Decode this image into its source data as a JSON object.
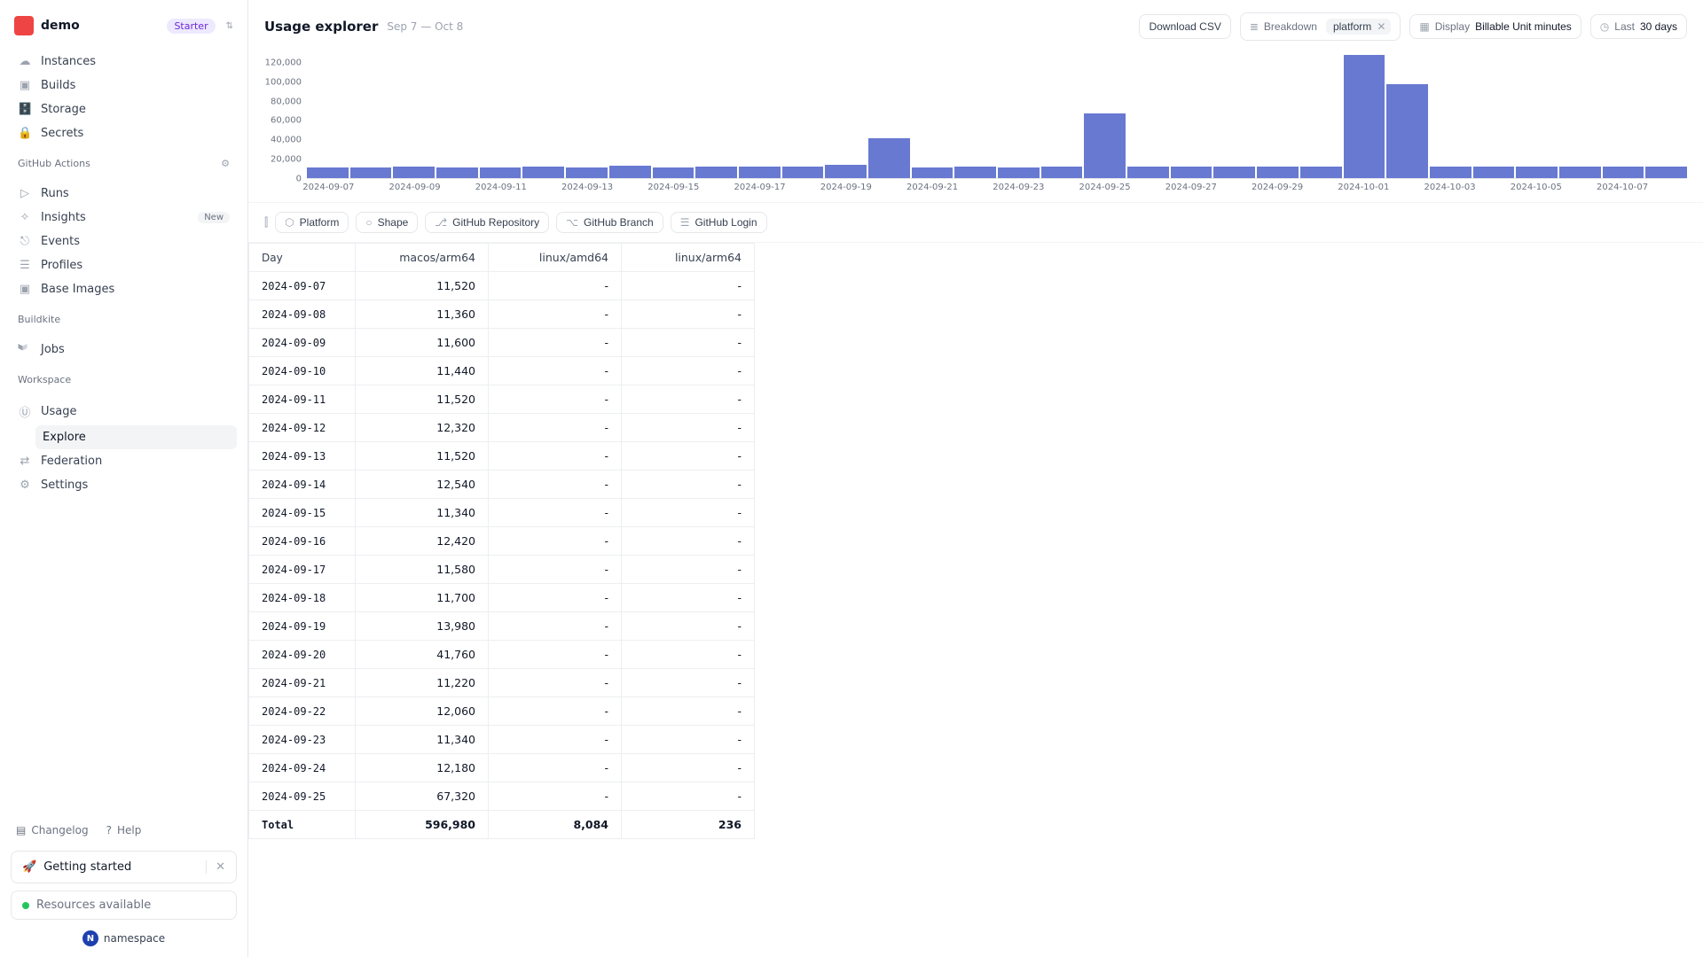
{
  "workspace": {
    "name": "demo",
    "badge": "Starter"
  },
  "sidebar": {
    "main": [
      {
        "icon": "☁",
        "label": "Instances"
      },
      {
        "icon": "▣",
        "label": "Builds"
      },
      {
        "icon": "🗄️",
        "label": "Storage"
      },
      {
        "icon": "🔒",
        "label": "Secrets"
      }
    ],
    "section_gh": "GitHub Actions",
    "gh": [
      {
        "icon": "▷",
        "label": "Runs"
      },
      {
        "icon": "✧",
        "label": "Insights",
        "pill": "New"
      },
      {
        "icon": "⎋",
        "label": "Events"
      },
      {
        "icon": "☰",
        "label": "Profiles"
      },
      {
        "icon": "▣",
        "label": "Base Images"
      }
    ],
    "section_bk": "Buildkite",
    "bk": [
      {
        "label": "Jobs"
      }
    ],
    "section_ws": "Workspace",
    "ws": [
      {
        "icon": "Ⓤ",
        "label": "Usage",
        "children": [
          {
            "label": "Explore",
            "active": true
          }
        ]
      },
      {
        "icon": "⇄",
        "label": "Federation"
      },
      {
        "icon": "⚙",
        "label": "Settings"
      }
    ],
    "footer": {
      "changelog": "Changelog",
      "help": "Help",
      "getting_started": "Getting started",
      "resources": "Resources available",
      "brand": "namespace"
    }
  },
  "header": {
    "title": "Usage explorer",
    "range": "Sep 7 — Oct 8",
    "download": "Download CSV",
    "breakdown_k": "Breakdown",
    "breakdown_chip": "platform",
    "display_k": "Display",
    "display_v": "Billable Unit minutes",
    "last_k": "Last",
    "last_v": "30 days"
  },
  "chart_data": {
    "type": "bar",
    "title": "",
    "xlabel": "",
    "ylabel": "",
    "ylim": [
      0,
      130000
    ],
    "yticks": [
      0,
      20000,
      40000,
      60000,
      80000,
      100000,
      120000
    ],
    "ytick_labels": [
      "0",
      "20,000",
      "40,000",
      "60,000",
      "80,000",
      "100,000",
      "120,000"
    ],
    "categories": [
      "2024-09-07",
      "2024-09-08",
      "2024-09-09",
      "2024-09-10",
      "2024-09-11",
      "2024-09-12",
      "2024-09-13",
      "2024-09-14",
      "2024-09-15",
      "2024-09-16",
      "2024-09-17",
      "2024-09-18",
      "2024-09-19",
      "2024-09-20",
      "2024-09-21",
      "2024-09-22",
      "2024-09-23",
      "2024-09-24",
      "2024-09-25",
      "2024-09-26",
      "2024-09-27",
      "2024-09-28",
      "2024-09-29",
      "2024-09-30",
      "2024-10-01",
      "2024-10-02",
      "2024-10-03",
      "2024-10-04",
      "2024-10-05",
      "2024-10-06",
      "2024-10-07",
      "2024-10-08"
    ],
    "xtick_every": 2,
    "values": [
      11520,
      11360,
      11600,
      11440,
      11520,
      12320,
      11520,
      12540,
      11340,
      12420,
      11580,
      11700,
      13980,
      41760,
      11220,
      12060,
      11340,
      12180,
      67320,
      12000,
      12000,
      12000,
      12000,
      12000,
      128000,
      98000,
      12000,
      12000,
      12000,
      12000,
      12000,
      12000
    ]
  },
  "filters": {
    "buttons": [
      {
        "icon": "⬡",
        "label": "Platform"
      },
      {
        "icon": "○",
        "label": "Shape"
      },
      {
        "icon": "⎇",
        "label": "GitHub Repository"
      },
      {
        "icon": "⌥",
        "label": "GitHub Branch"
      },
      {
        "icon": "☰",
        "label": "GitHub Login"
      }
    ]
  },
  "table": {
    "columns": [
      "Day",
      "macos/arm64",
      "linux/amd64",
      "linux/arm64"
    ],
    "rows": [
      {
        "day": "2024-09-07",
        "a": "11,520",
        "b": "-",
        "c": "-"
      },
      {
        "day": "2024-09-08",
        "a": "11,360",
        "b": "-",
        "c": "-"
      },
      {
        "day": "2024-09-09",
        "a": "11,600",
        "b": "-",
        "c": "-"
      },
      {
        "day": "2024-09-10",
        "a": "11,440",
        "b": "-",
        "c": "-"
      },
      {
        "day": "2024-09-11",
        "a": "11,520",
        "b": "-",
        "c": "-"
      },
      {
        "day": "2024-09-12",
        "a": "12,320",
        "b": "-",
        "c": "-"
      },
      {
        "day": "2024-09-13",
        "a": "11,520",
        "b": "-",
        "c": "-"
      },
      {
        "day": "2024-09-14",
        "a": "12,540",
        "b": "-",
        "c": "-"
      },
      {
        "day": "2024-09-15",
        "a": "11,340",
        "b": "-",
        "c": "-"
      },
      {
        "day": "2024-09-16",
        "a": "12,420",
        "b": "-",
        "c": "-"
      },
      {
        "day": "2024-09-17",
        "a": "11,580",
        "b": "-",
        "c": "-"
      },
      {
        "day": "2024-09-18",
        "a": "11,700",
        "b": "-",
        "c": "-"
      },
      {
        "day": "2024-09-19",
        "a": "13,980",
        "b": "-",
        "c": "-"
      },
      {
        "day": "2024-09-20",
        "a": "41,760",
        "b": "-",
        "c": "-"
      },
      {
        "day": "2024-09-21",
        "a": "11,220",
        "b": "-",
        "c": "-"
      },
      {
        "day": "2024-09-22",
        "a": "12,060",
        "b": "-",
        "c": "-"
      },
      {
        "day": "2024-09-23",
        "a": "11,340",
        "b": "-",
        "c": "-"
      },
      {
        "day": "2024-09-24",
        "a": "12,180",
        "b": "-",
        "c": "-"
      },
      {
        "day": "2024-09-25",
        "a": "67,320",
        "b": "-",
        "c": "-"
      }
    ],
    "total": {
      "label": "Total",
      "a": "596,980",
      "b": "8,084",
      "c": "236"
    }
  }
}
